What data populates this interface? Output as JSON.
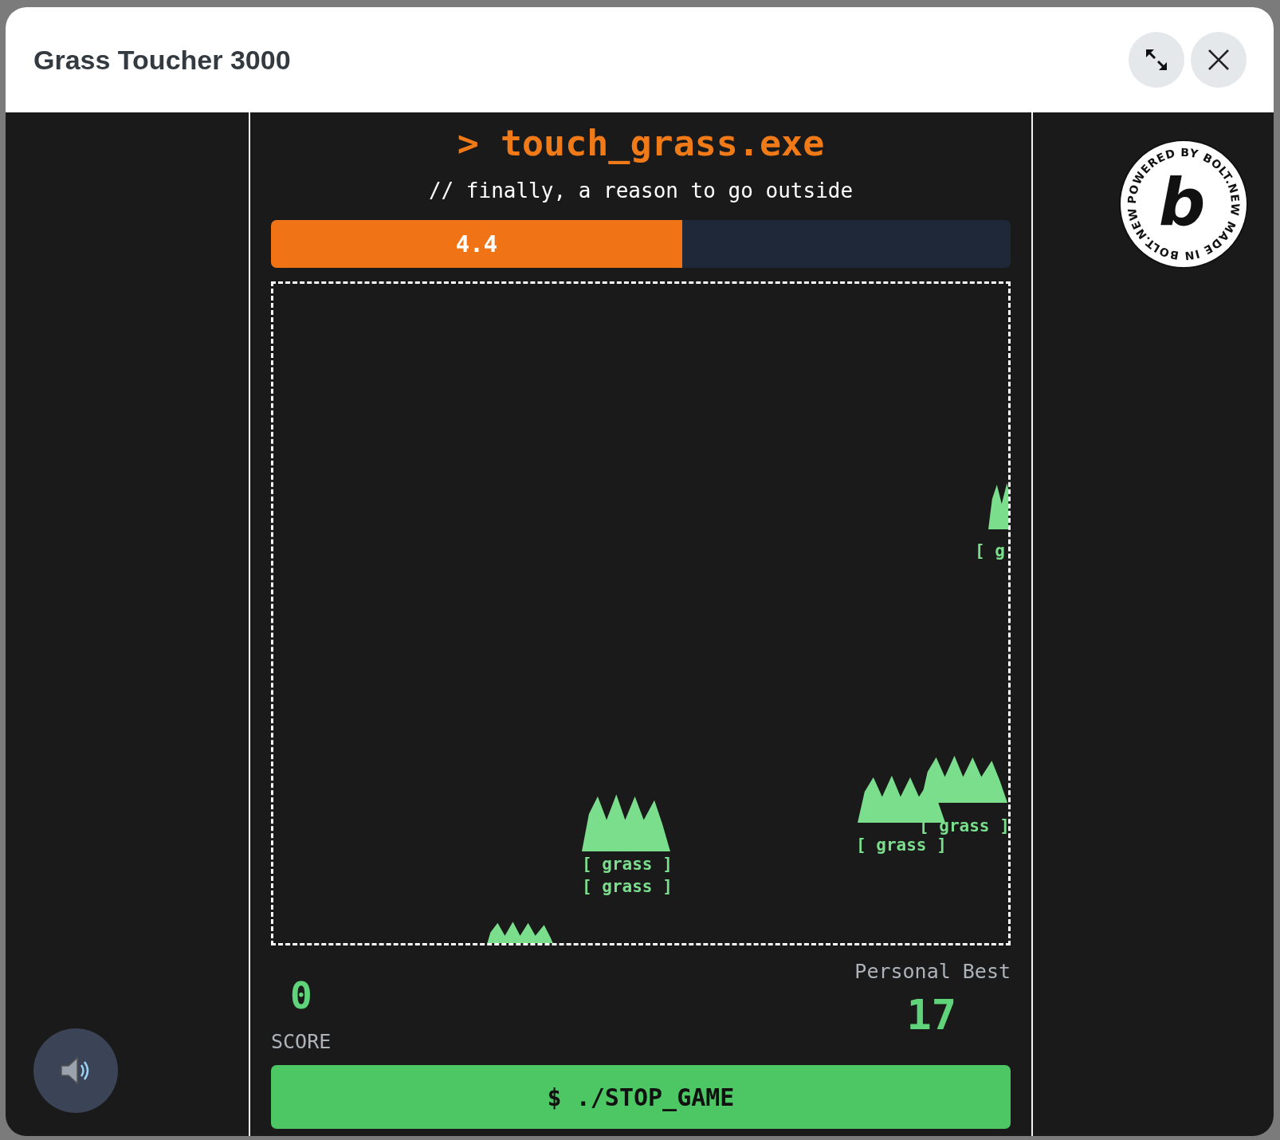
{
  "window": {
    "title": "Grass Toucher 3000"
  },
  "header": {
    "title": "> touch_grass.exe",
    "subtitle": "// finally, a reason to go outside"
  },
  "timer": {
    "level": 0.556,
    "reading": "4.4"
  },
  "grass_patches": [
    {
      "label": "[ g"
    },
    {
      "label": "[ grass ]"
    },
    {
      "label": "[ grass ]"
    },
    {
      "label": "[ grass ]"
    },
    {
      "label": "[ grass ]"
    }
  ],
  "score": {
    "value": "0",
    "label": "SCORE"
  },
  "personal_best": {
    "label": "Personal Best",
    "value": "17"
  },
  "action_button": {
    "label": "$ ./STOP_GAME"
  },
  "badge": {
    "ring_text": "POWERED BY BOLT.NEW MADE IN BOLT.NEW",
    "letter": "b"
  }
}
